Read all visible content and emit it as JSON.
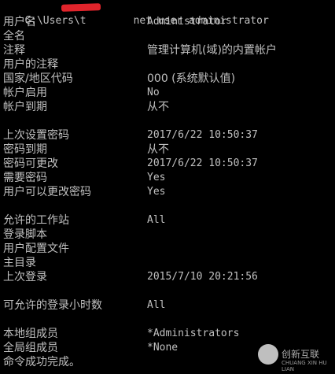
{
  "console": {
    "prompt": "C:\\Users\\t",
    "command": "net user administrator",
    "rows": [
      {
        "label": "用户名",
        "value": "Administrator"
      },
      {
        "label": "全名",
        "value": ""
      },
      {
        "label": "注释",
        "value": "管理计算机(域)的内置帐户"
      },
      {
        "label": "用户的注释",
        "value": ""
      },
      {
        "label": "国家/地区代码",
        "value": "000 (系统默认值)"
      },
      {
        "label": "帐户启用",
        "value": "No"
      },
      {
        "label": "帐户到期",
        "value": "从不"
      },
      {
        "label": "",
        "value": ""
      },
      {
        "label": "上次设置密码",
        "value": "2017/6/22 10:50:37"
      },
      {
        "label": "密码到期",
        "value": "从不"
      },
      {
        "label": "密码可更改",
        "value": "2017/6/22 10:50:37"
      },
      {
        "label": "需要密码",
        "value": "Yes"
      },
      {
        "label": "用户可以更改密码",
        "value": "Yes"
      },
      {
        "label": "",
        "value": ""
      },
      {
        "label": "允许的工作站",
        "value": "All"
      },
      {
        "label": "登录脚本",
        "value": ""
      },
      {
        "label": "用户配置文件",
        "value": ""
      },
      {
        "label": "主目录",
        "value": ""
      },
      {
        "label": "上次登录",
        "value": "2015/7/10 20:21:56"
      },
      {
        "label": "",
        "value": ""
      },
      {
        "label": "可允许的登录小时数",
        "value": "All"
      },
      {
        "label": "",
        "value": ""
      },
      {
        "label": "本地组成员",
        "value": "*Administrators"
      },
      {
        "label": "全局组成员",
        "value": "*None"
      },
      {
        "label": "命令成功完成。",
        "value": ""
      }
    ]
  },
  "watermark": {
    "name": "创新互联",
    "sub": "CHUANG XIN HU LIAN"
  },
  "colors": {
    "background": "#000000",
    "text": "#c0c0c0",
    "redaction": "#e0242b"
  }
}
